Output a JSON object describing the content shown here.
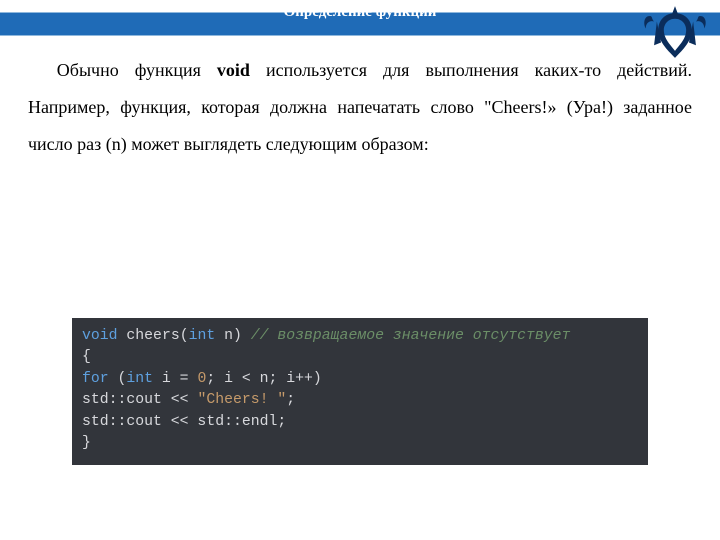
{
  "header": {
    "title": "Определение функции"
  },
  "paragraph": {
    "pre_bold": "Обычно функция ",
    "bold": "void",
    "post_bold": " используется для выполнения каких-то действий. Например, функция, которая должна напечатать слово \"Cheers!» (Ура!) заданное число раз (n) может выглядеть следующим образом:"
  },
  "code": {
    "l1": {
      "kw1": "void",
      "sp1": " ",
      "id1": "cheers(",
      "kw2": "int",
      "id2": " n) ",
      "cmt": "// возвращаемое значение отсутствует"
    },
    "l2": {
      "txt": "{"
    },
    "l3": {
      "kw1": "for",
      "txt1": " (",
      "kw2": "int",
      "txt2": " i = ",
      "num": "0",
      "txt3": "; i < n; i++)"
    },
    "l4": {
      "txt1": "std::cout << ",
      "str": "\"Cheers! \"",
      "txt2": ";"
    },
    "l5": {
      "txt": "std::cout << std::endl;"
    },
    "l6": {
      "txt": "}"
    }
  }
}
